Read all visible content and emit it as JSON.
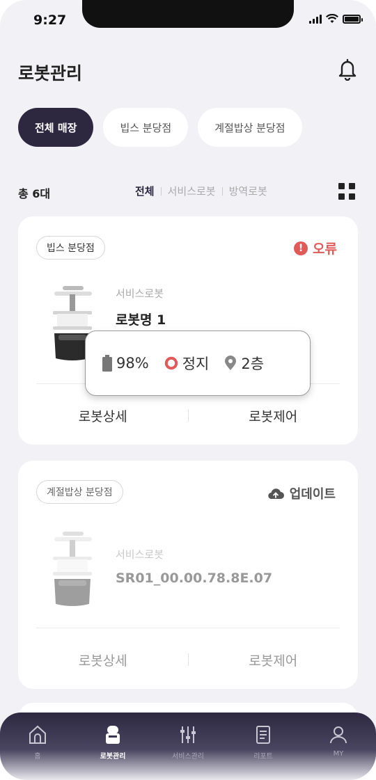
{
  "status_bar": {
    "time": "9:27"
  },
  "header": {
    "title": "로봇관리"
  },
  "store_tabs": [
    {
      "label": "전체 매장",
      "active": true
    },
    {
      "label": "빕스 분당점",
      "active": false
    },
    {
      "label": "계절밥상 분당점",
      "active": false
    }
  ],
  "summary": {
    "total": "총 6대"
  },
  "filters": [
    {
      "label": "전체",
      "active": true
    },
    {
      "label": "서비스로봇",
      "active": false
    },
    {
      "label": "방역로봇",
      "active": false
    }
  ],
  "robots": [
    {
      "store": "빕스 분당점",
      "status": "오류",
      "status_color": "#e05a5a",
      "type": "서비스로봇",
      "name": "로봇명 1",
      "detail_label": "로봇상세",
      "control_label": "로봇제어",
      "info": {
        "battery": "98%",
        "state": "정지",
        "floor": "2층"
      }
    },
    {
      "store": "계절밥상 분당점",
      "status": "업데이트",
      "type": "서비스로봇",
      "name": "SR01_00.00.78.8E.07",
      "detail_label": "로봇상세",
      "control_label": "로봇제어"
    }
  ],
  "bottom_nav": [
    {
      "label": "홈",
      "icon": "home-icon",
      "active": false
    },
    {
      "label": "로봇관리",
      "icon": "robot-icon",
      "active": true
    },
    {
      "label": "서비스관리",
      "icon": "sliders-icon",
      "active": false
    },
    {
      "label": "리포트",
      "icon": "report-icon",
      "active": false
    },
    {
      "label": "MY",
      "icon": "user-icon",
      "active": false
    }
  ]
}
